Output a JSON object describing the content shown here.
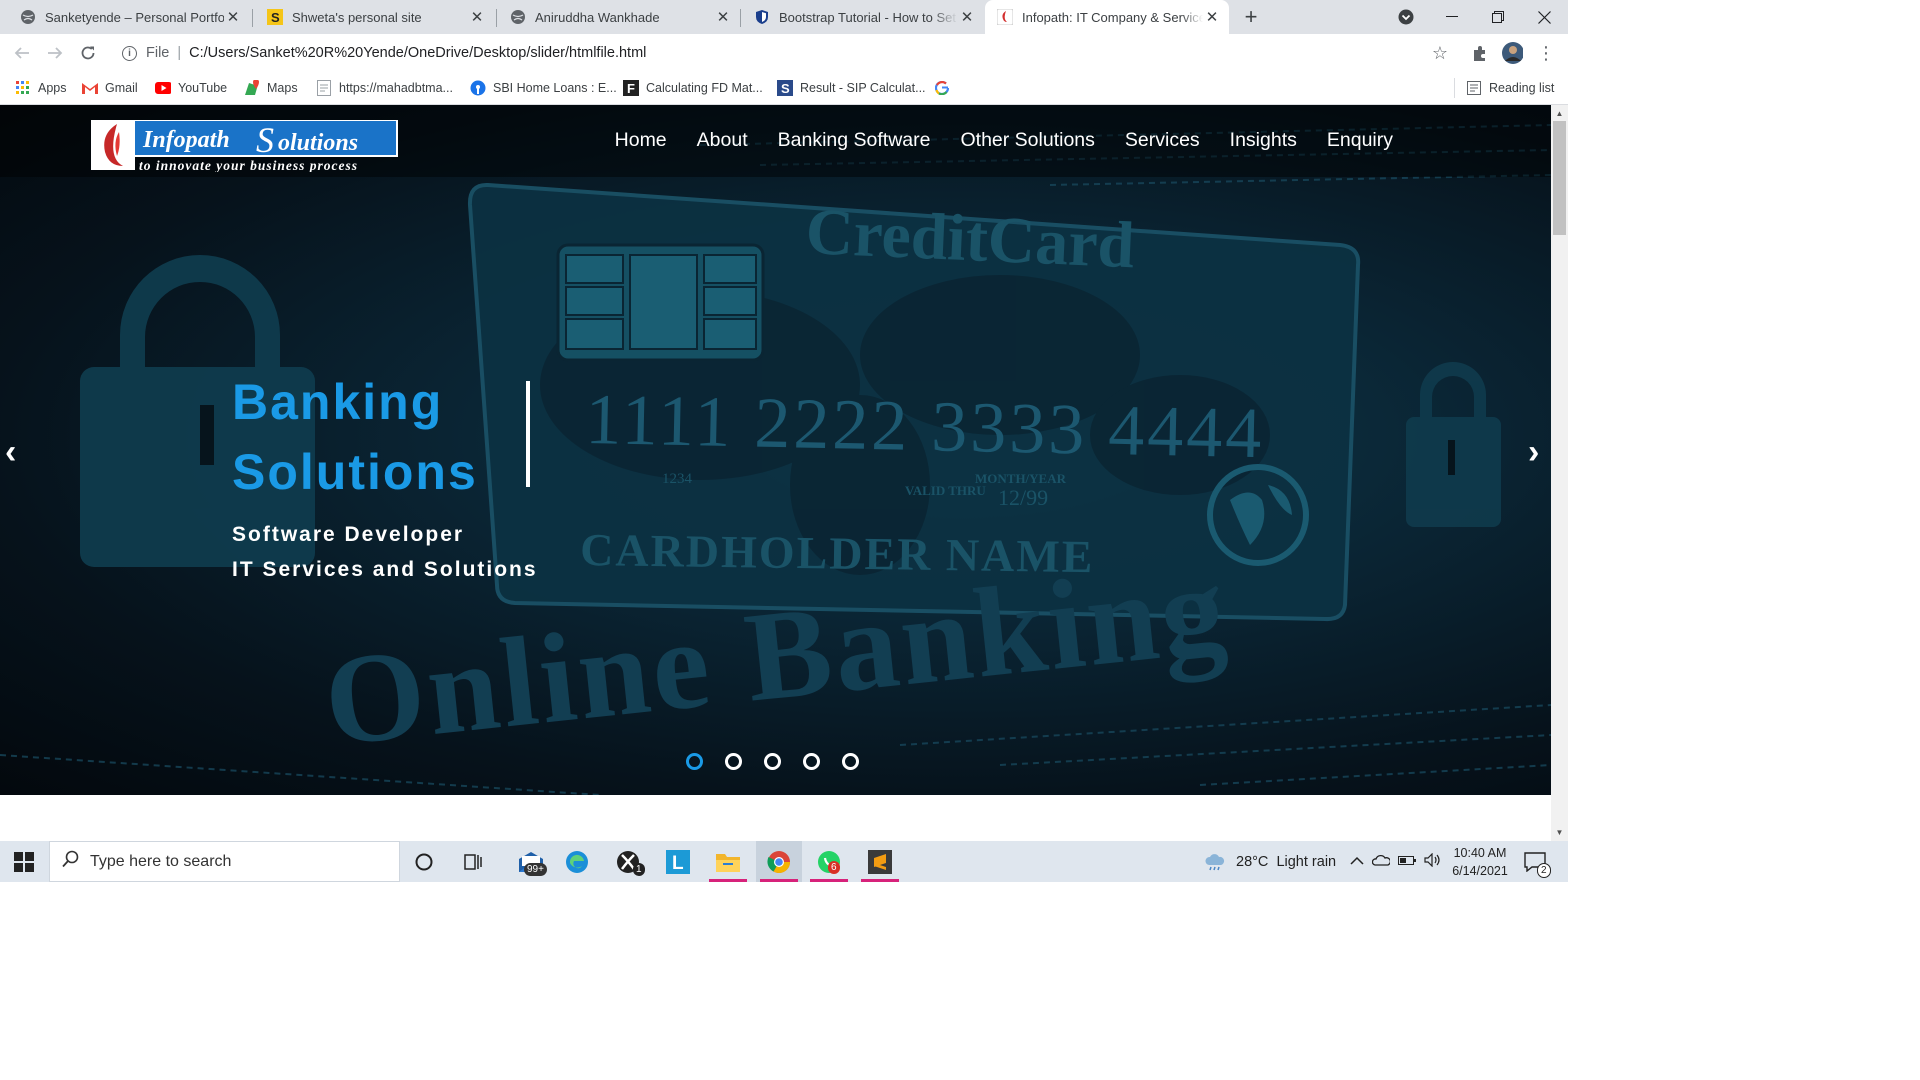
{
  "browser": {
    "tabs": [
      {
        "title": "Sanketyende – Personal Portfolio",
        "icon": "globe-icon",
        "active": false
      },
      {
        "title": "Shweta's personal site",
        "icon": "s-logo-icon",
        "active": false
      },
      {
        "title": "Aniruddha Wankhade",
        "icon": "globe-icon",
        "active": false
      },
      {
        "title": "Bootstrap Tutorial - How to Set U",
        "icon": "shield-icon",
        "active": false
      },
      {
        "title": "Infopath: IT Company & Services",
        "icon": "infopath-icon",
        "active": true
      }
    ],
    "address": {
      "scheme": "File",
      "url": "C:/Users/Sanket%20R%20Yende/OneDrive/Desktop/slider/htmlfile.html"
    },
    "bookmarks": [
      {
        "label": "Apps",
        "icon": "apps-grid-icon"
      },
      {
        "label": "Gmail",
        "icon": "gmail-icon"
      },
      {
        "label": "YouTube",
        "icon": "youtube-icon"
      },
      {
        "label": "Maps",
        "icon": "maps-icon"
      },
      {
        "label": "https://mahadbtma...",
        "icon": "page-icon"
      },
      {
        "label": "SBI Home Loans : E...",
        "icon": "sbi-icon"
      },
      {
        "label": "Calculating FD Mat...",
        "icon": "f-logo-icon"
      },
      {
        "label": "Result - SIP Calculat...",
        "icon": "s-logo-icon"
      },
      {
        "label": "",
        "icon": "google-icon"
      }
    ],
    "reading_list": "Reading list"
  },
  "site": {
    "logo": {
      "name_a": "Infopath",
      "name_s": "S",
      "name_b": "olutions",
      "tagline": "to innovate your business process"
    },
    "nav": [
      "Home",
      "About",
      "Banking Software",
      "Other Solutions",
      "Services",
      "Insights",
      "Enquiry"
    ],
    "hero": {
      "heading_line1": "Banking",
      "heading_line2": "Solutions",
      "sub_line1": "Software Developer",
      "sub_line2": "IT Services and Solutions",
      "bg_text": {
        "card_title": "CreditCard",
        "card_number": "1111 2222 3333 4444",
        "card_small": "1234",
        "valid_thru": "VALID THRU",
        "month_year": "MONTH/YEAR",
        "expiry": "12/99",
        "cardholder": "CARDHOLDER NAME",
        "online_banking": "Online Banking"
      },
      "slide_count": 5,
      "active_slide": 1,
      "prev": "‹",
      "next": "›"
    }
  },
  "taskbar": {
    "search_placeholder": "Type here to search",
    "mail_badge": "99+",
    "xbox_badge": "1",
    "whatsapp_badge": "6",
    "weather": "28°C  Light rain",
    "time": "10:40 AM",
    "date": "6/14/2021",
    "notifications": "2"
  },
  "colors": {
    "accent": "#1a9ae6",
    "hero_bg": "#0a2433",
    "taskbar_active": "#d7227a"
  }
}
